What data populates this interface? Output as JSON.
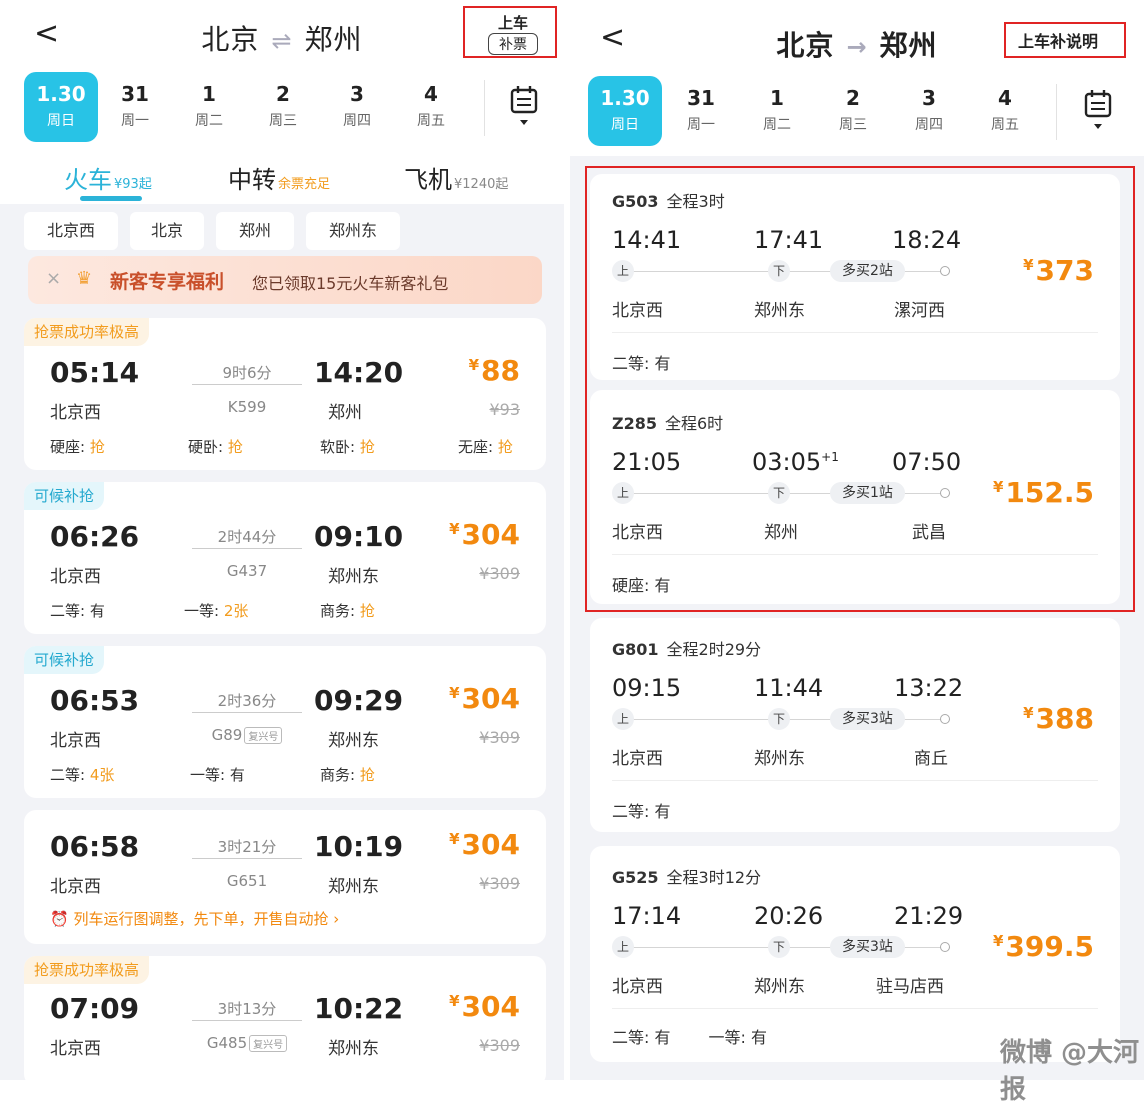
{
  "left": {
    "back": "<",
    "route": {
      "from": "北京",
      "arrow": "⇌",
      "to": "郑州"
    },
    "board_button": {
      "line1": "上车",
      "line2": "补票"
    },
    "dates": [
      {
        "day": "1.30",
        "week": "周日"
      },
      {
        "day": "31",
        "week": "周一"
      },
      {
        "day": "1",
        "week": "周二"
      },
      {
        "day": "2",
        "week": "周三"
      },
      {
        "day": "3",
        "week": "周四"
      },
      {
        "day": "4",
        "week": "周五"
      }
    ],
    "tabs": [
      {
        "label": "火车",
        "sub": "¥93起"
      },
      {
        "label": "中转",
        "sub": "余票充足"
      },
      {
        "label": "飞机",
        "sub": "¥1240起"
      }
    ],
    "stations": [
      "北京西",
      "北京",
      "郑州",
      "郑州东"
    ],
    "promo": {
      "close": "×",
      "title": "新客专享福利",
      "message": "您已领取15元火车新客礼包"
    },
    "trains": [
      {
        "tag": "抢票成功率极高",
        "dep": "05:14",
        "arr": "14:20",
        "duration": "9时6分",
        "code": "K599",
        "from": "北京西",
        "to": "郑州",
        "price": "88",
        "orig": "¥93",
        "seats": [
          {
            "name": "硬座: ",
            "val": "抢"
          },
          {
            "name": "硬卧: ",
            "val": "抢"
          },
          {
            "name": "软卧: ",
            "val": "抢"
          },
          {
            "name": "无座: ",
            "val": "抢"
          }
        ]
      },
      {
        "tag": "可候补抢",
        "dep": "06:26",
        "arr": "09:10",
        "duration": "2时44分",
        "code": "G437",
        "from": "北京西",
        "to": "郑州东",
        "price": "304",
        "orig": "¥309",
        "seats": [
          {
            "name": "二等: ",
            "val": "有"
          },
          {
            "name": "一等: ",
            "val": "2张"
          },
          {
            "name": "商务: ",
            "val": "抢"
          }
        ]
      },
      {
        "tag": "可候补抢",
        "dep": "06:53",
        "arr": "09:29",
        "duration": "2时36分",
        "code": "G89",
        "fx": "复兴号",
        "from": "北京西",
        "to": "郑州东",
        "price": "304",
        "orig": "¥309",
        "seats": [
          {
            "name": "二等: ",
            "val": "4张"
          },
          {
            "name": "一等: ",
            "val": "有"
          },
          {
            "name": "商务: ",
            "val": "抢"
          }
        ]
      },
      {
        "dep": "06:58",
        "arr": "10:19",
        "duration": "3时21分",
        "code": "G651",
        "from": "北京西",
        "to": "郑州东",
        "price": "304",
        "orig": "¥309",
        "notice": "⏰ 列车运行图调整，先下单，开售自动抢 ›"
      },
      {
        "tag": "抢票成功率极高",
        "dep": "07:09",
        "arr": "10:22",
        "duration": "3时13分",
        "code": "G485",
        "fx": "复兴号",
        "from": "北京西",
        "to": "郑州东",
        "price": "304",
        "orig": "¥309"
      }
    ]
  },
  "right": {
    "back": "<",
    "route": {
      "from": "北京",
      "arrow": "→",
      "to": "郑州"
    },
    "board_note": "上车补说明",
    "dates": [
      {
        "day": "1.30",
        "week": "周日"
      },
      {
        "day": "31",
        "week": "周一"
      },
      {
        "day": "1",
        "week": "周二"
      },
      {
        "day": "2",
        "week": "周三"
      },
      {
        "day": "3",
        "week": "周四"
      },
      {
        "day": "4",
        "week": "周五"
      }
    ],
    "board_label": "上",
    "alight_label": "下",
    "trains": [
      {
        "code": "G503",
        "total": "全程3时",
        "t1": "14:41",
        "t2": "17:41",
        "t3": "18:24",
        "s1": "北京西",
        "s2": "郑州东",
        "s3": "漯河西",
        "extra": "多买2站",
        "price": "373",
        "seats": [
          "二等: 有"
        ]
      },
      {
        "code": "Z285",
        "total": "全程6时",
        "t1": "21:05",
        "t2": "03:05",
        "t2sup": "+1",
        "t3": "07:50",
        "s1": "北京西",
        "s2": "郑州",
        "s3": "武昌",
        "extra": "多买1站",
        "price": "152.5",
        "seats": [
          "硬座: 有"
        ]
      },
      {
        "code": "G801",
        "total": "全程2时29分",
        "t1": "09:15",
        "t2": "11:44",
        "t3": "13:22",
        "s1": "北京西",
        "s2": "郑州东",
        "s3": "商丘",
        "extra": "多买3站",
        "price": "388",
        "seats": [
          "二等: 有"
        ]
      },
      {
        "code": "G525",
        "total": "全程3时12分",
        "t1": "17:14",
        "t2": "20:26",
        "t3": "21:29",
        "s1": "北京西",
        "s2": "郑州东",
        "s3": "驻马店西",
        "extra": "多买3站",
        "price": "399.5",
        "seats": [
          "二等: 有",
          "一等: 有"
        ]
      }
    ]
  },
  "currency": "¥",
  "watermark": "微博 @大河报",
  "colors": {
    "accent": "#28c3e6",
    "price": "#f2890f",
    "highlight_box": "#e02424"
  }
}
